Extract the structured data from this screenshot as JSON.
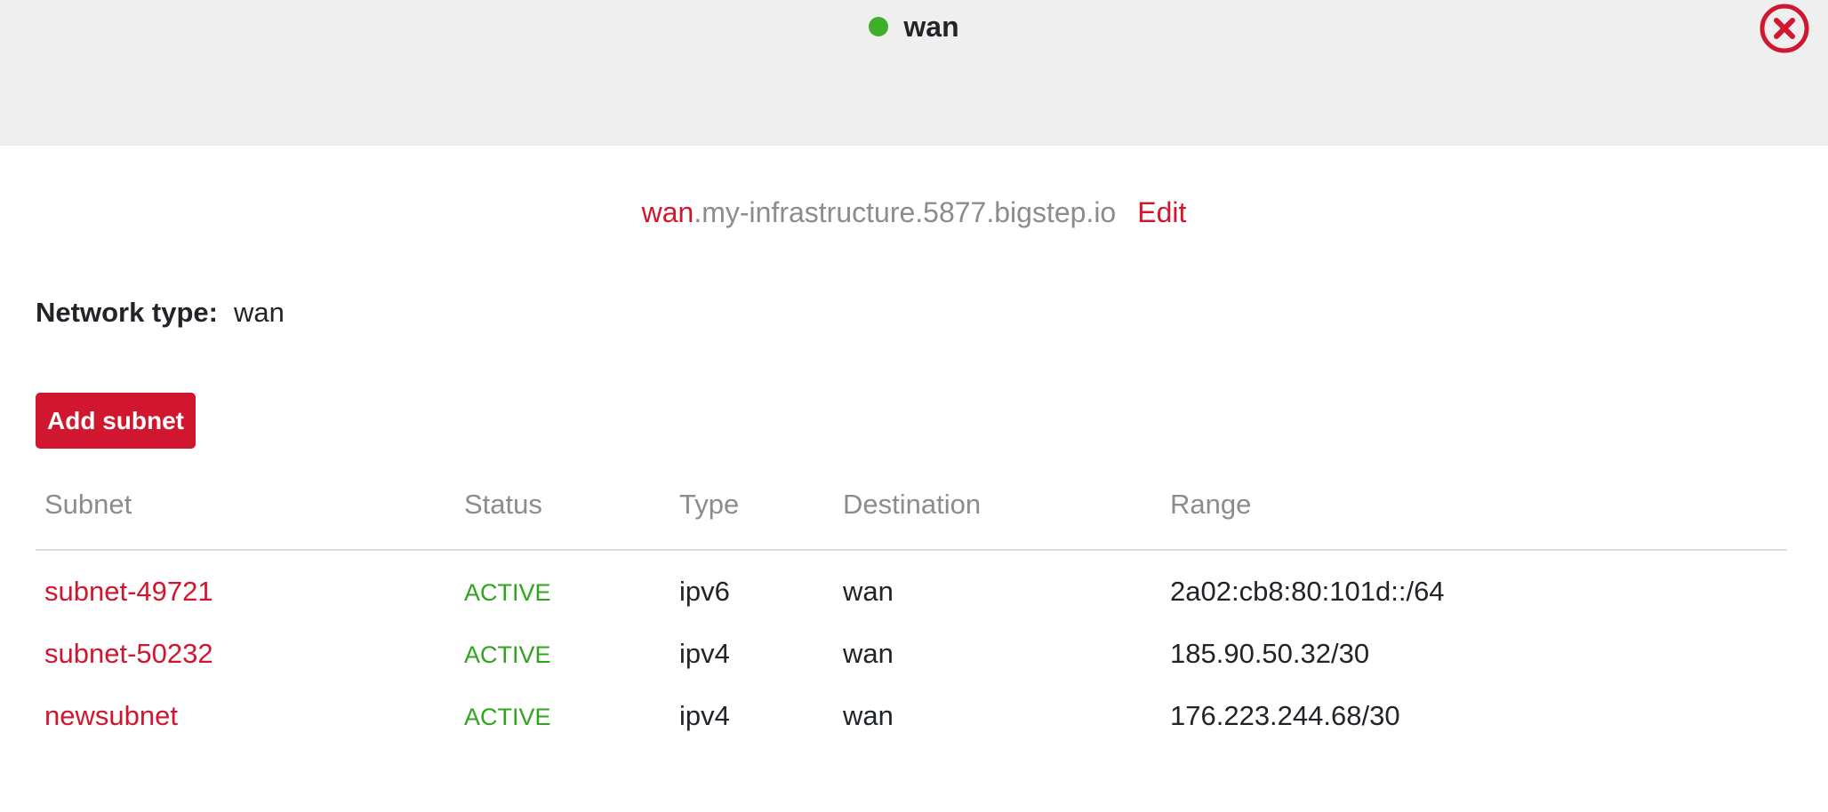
{
  "header": {
    "title": "wan",
    "status_color": "#3fae29",
    "close_icon": "close-circle-icon"
  },
  "fqdn": {
    "prefix": "wan",
    "suffix": ".my-infrastructure.5877.bigstep.io",
    "edit_label": "Edit"
  },
  "network_type": {
    "label": "Network type:",
    "value": "wan"
  },
  "add_subnet_label": "Add subnet",
  "table": {
    "columns": [
      "Subnet",
      "Status",
      "Type",
      "Destination",
      "Range"
    ],
    "rows": [
      {
        "subnet": "subnet-49721",
        "status": "ACTIVE",
        "type": "ipv6",
        "destination": "wan",
        "range": "2a02:cb8:80:101d::/64"
      },
      {
        "subnet": "subnet-50232",
        "status": "ACTIVE",
        "type": "ipv4",
        "destination": "wan",
        "range": "185.90.50.32/30"
      },
      {
        "subnet": "newsubnet",
        "status": "ACTIVE",
        "type": "ipv4",
        "destination": "wan",
        "range": "176.223.244.68/30"
      }
    ]
  },
  "colors": {
    "accent": "#d0172f",
    "active": "#2fa51d",
    "muted": "#8c8c8c"
  }
}
